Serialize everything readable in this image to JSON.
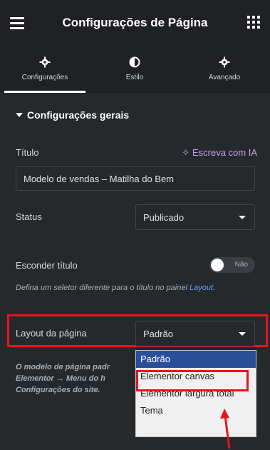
{
  "header": {
    "title": "Configurações de Página"
  },
  "tabs": [
    {
      "label": "Configurações",
      "icon": "gear-icon",
      "active": true
    },
    {
      "label": "Estilo",
      "icon": "contrast-icon",
      "active": false
    },
    {
      "label": "Avançado",
      "icon": "gear-icon",
      "active": false
    }
  ],
  "section": {
    "title": "Configurações gerais"
  },
  "fields": {
    "title_label": "Título",
    "ai_link": "Escreva com IA",
    "title_value": "Modelo de vendas – Matilha do Bem",
    "status_label": "Status",
    "status_value": "Publicado",
    "hide_title_label": "Esconder título",
    "hide_title_toggle": "Não",
    "hide_title_help": "Defina um seletor diferente para o título no painel",
    "hide_title_help_link": "Layout.",
    "layout_label": "Layout da página",
    "layout_value": "Padrão",
    "layout_help_line1": "O modelo de página padr",
    "layout_help_line2": "Elementor → Menu do h",
    "layout_help_line3": "Configurações do site."
  },
  "dropdown": {
    "options": [
      "Padrão",
      "Elementor canvas",
      "Elementor largura total",
      "Tema"
    ],
    "selected_index": 0
  },
  "colors": {
    "background": "#26292c",
    "header": "#1f2124",
    "accent_ai": "#c9a0f5",
    "link": "#6fa3ff",
    "highlight": "#e8141b",
    "dropdown_selected": "#2a4f9a"
  }
}
